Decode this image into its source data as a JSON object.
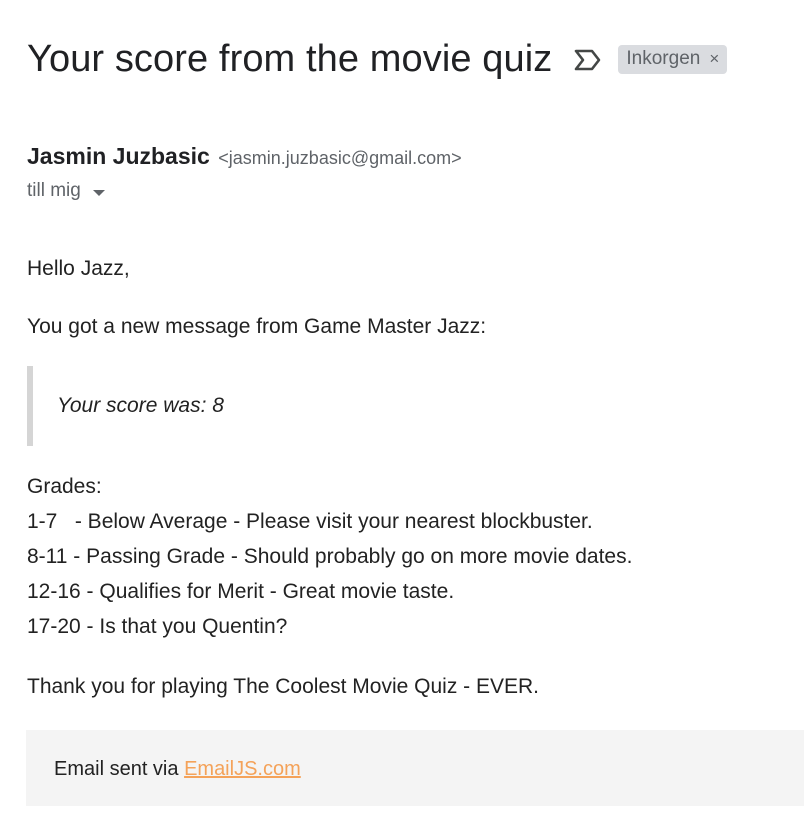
{
  "email": {
    "subject": "Your score from the movie quiz",
    "label_chip": "Inkorgen",
    "label_close": "×",
    "sender_name": "Jasmin Juzbasic",
    "sender_email": "<jasmin.juzbasic@gmail.com>",
    "recipient_text": "till mig"
  },
  "body": {
    "greeting": "Hello Jazz,",
    "intro": "You got a new message from Game Master Jazz:",
    "quote": "Your score was: 8",
    "grades_title": "Grades:",
    "grades": [
      "1-7   - Below Average - Please visit your nearest blockbuster.",
      "8-11 - Passing Grade - Should probably go on more movie dates.",
      "12-16 - Qualifies for Merit - Great movie taste.",
      "17-20 - Is that you Quentin?"
    ],
    "closing": "Thank you for playing The Coolest Movie Quiz - EVER."
  },
  "footer": {
    "prefix": "Email sent via ",
    "link_text": "EmailJS.com"
  },
  "colors": {
    "link": "#f4a259",
    "chip_bg": "#dadce0",
    "footer_bg": "#f4f4f4"
  },
  "icons": {
    "label": "label-outline-icon",
    "details": "caret-down-icon"
  }
}
